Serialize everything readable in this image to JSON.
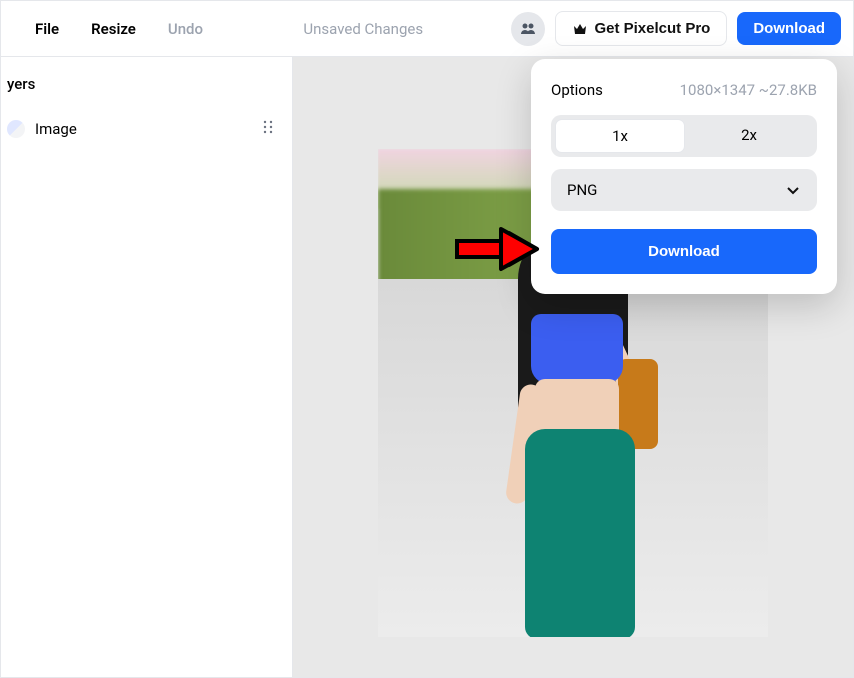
{
  "header": {
    "file": "File",
    "resize": "Resize",
    "undo": "Undo",
    "unsaved": "Unsaved Changes",
    "pro_label": "Get Pixelcut Pro",
    "download": "Download"
  },
  "sidebar": {
    "title": "yers",
    "layer_name": "Image"
  },
  "panel": {
    "options": "Options",
    "meta": "1080×1347 ~27.8KB",
    "opt1": "1x",
    "opt2": "2x",
    "format": "PNG",
    "download": "Download"
  },
  "colors": {
    "primary": "#1868fb",
    "arrow": "#ff0000"
  }
}
